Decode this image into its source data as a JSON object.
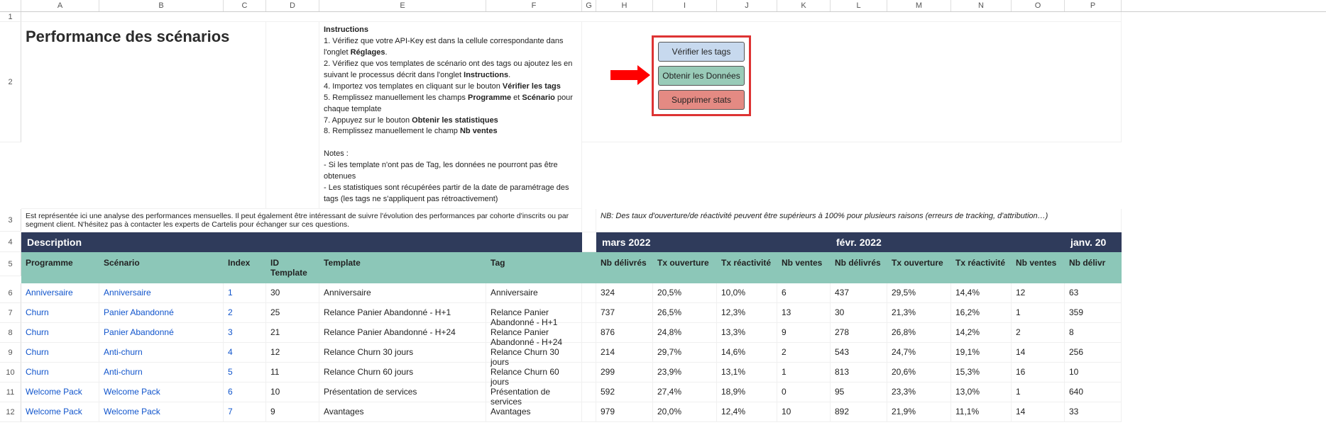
{
  "columns": [
    "",
    "A",
    "B",
    "C",
    "D",
    "E",
    "F",
    "G",
    "H",
    "I",
    "J",
    "K",
    "L",
    "M",
    "N",
    "O",
    "P"
  ],
  "title": "Performance des scénarios",
  "instructions": {
    "heading": "Instructions",
    "lines": [
      "1. Vérifiez que votre API-Key est dans la cellule correspondante dans l'onglet Réglages.",
      "2. Vérifiez que vos templates de scénario ont des tags ou ajoutez les en suivant le processus décrit dans l'onglet Instructions.",
      "4. Importez vos templates en cliquant sur le bouton Vérifier les tags",
      "5. Remplissez manuellement les champs Programme et Scénario pour chaque template",
      "7. Appuyez sur le bouton Obtenir les statistiques",
      "8. Remplissez manuellement le champ Nb ventes"
    ],
    "notes_heading": "Notes :",
    "notes": [
      "- Si les template n'ont pas de Tag, les données ne pourront pas être obtenues",
      "- Les statistiques sont récupérées partir de la date de paramétrage des tags (les tags ne s'appliquent pas rétroactivement)"
    ]
  },
  "nb_note": "NB: Des taux d'ouverture/de réactivité peuvent être supérieurs à 100% pour plusieurs raisons (erreurs de tracking, d'attribution…)",
  "sub_description": "Est représentée ici une analyse des performances mensuelles. Il peut également être intéressant de suivre l'évolution des performances par cohorte d'inscrits ou par segment client. N'hésitez pas à contacter les experts de Cartelis pour échanger sur ces questions.",
  "buttons": {
    "verify": "Vérifier les tags",
    "get": "Obtenir les Données",
    "delete": "Supprimer stats"
  },
  "sections": {
    "description": "Description",
    "mars": "mars 2022",
    "fevr": "févr. 2022",
    "janv": "janv. 20"
  },
  "headers": {
    "programme": "Programme",
    "scenario": "Scénario",
    "index": "Index",
    "id_template": "ID Template",
    "template": "Template",
    "tag": "Tag",
    "nb_delivres": "Nb délivrés",
    "tx_ouv": "Tx ouverture",
    "tx_react": "Tx réactivité",
    "nb_ventes": "Nb ventes",
    "nb_delivr": "Nb délivr"
  },
  "rows": [
    {
      "n": 6,
      "programme": "Anniversaire",
      "scenario": "Anniversaire",
      "index": "1",
      "id_template": "30",
      "template": "Anniversaire",
      "tag": "Anniversaire",
      "m": {
        "d": "324",
        "o": "20,5%",
        "r": "10,0%",
        "v": "6"
      },
      "f": {
        "d": "437",
        "o": "29,5%",
        "r": "14,4%",
        "v": "12"
      },
      "j": {
        "d": "63"
      }
    },
    {
      "n": 7,
      "programme": "Churn",
      "scenario": "Panier Abandonné",
      "index": "2",
      "id_template": "25",
      "template": "Relance Panier Abandonné - H+1",
      "tag": "Relance Panier Abandonné - H+1",
      "m": {
        "d": "737",
        "o": "26,5%",
        "r": "12,3%",
        "v": "13"
      },
      "f": {
        "d": "30",
        "o": "21,3%",
        "r": "16,2%",
        "v": "1"
      },
      "j": {
        "d": "359"
      }
    },
    {
      "n": 8,
      "programme": "Churn",
      "scenario": "Panier Abandonné",
      "index": "3",
      "id_template": "21",
      "template": "Relance Panier Abandonné - H+24",
      "tag": "Relance Panier Abandonné - H+24",
      "m": {
        "d": "876",
        "o": "24,8%",
        "r": "13,3%",
        "v": "9"
      },
      "f": {
        "d": "278",
        "o": "26,8%",
        "r": "14,2%",
        "v": "2"
      },
      "j": {
        "d": "8"
      }
    },
    {
      "n": 9,
      "programme": "Churn",
      "scenario": "Anti-churn",
      "index": "4",
      "id_template": "12",
      "template": "Relance Churn 30 jours",
      "tag": "Relance Churn 30 jours",
      "m": {
        "d": "214",
        "o": "29,7%",
        "r": "14,6%",
        "v": "2"
      },
      "f": {
        "d": "543",
        "o": "24,7%",
        "r": "19,1%",
        "v": "14"
      },
      "j": {
        "d": "256"
      }
    },
    {
      "n": 10,
      "programme": "Churn",
      "scenario": "Anti-churn",
      "index": "5",
      "id_template": "11",
      "template": "Relance Churn 60 jours",
      "tag": "Relance Churn 60 jours",
      "m": {
        "d": "299",
        "o": "23,9%",
        "r": "13,1%",
        "v": "1"
      },
      "f": {
        "d": "813",
        "o": "20,6%",
        "r": "15,3%",
        "v": "16"
      },
      "j": {
        "d": "10"
      }
    },
    {
      "n": 11,
      "programme": "Welcome Pack",
      "scenario": "Welcome Pack",
      "index": "6",
      "id_template": "10",
      "template": "Présentation de services",
      "tag": "Présentation de services",
      "m": {
        "d": "592",
        "o": "27,4%",
        "r": "18,9%",
        "v": "0"
      },
      "f": {
        "d": "95",
        "o": "23,3%",
        "r": "13,0%",
        "v": "1"
      },
      "j": {
        "d": "640"
      }
    },
    {
      "n": 12,
      "programme": "Welcome Pack",
      "scenario": "Welcome Pack",
      "index": "7",
      "id_template": "9",
      "template": "Avantages",
      "tag": "Avantages",
      "m": {
        "d": "979",
        "o": "20,0%",
        "r": "12,4%",
        "v": "10"
      },
      "f": {
        "d": "892",
        "o": "21,9%",
        "r": "11,1%",
        "v": "14"
      },
      "j": {
        "d": "33"
      }
    }
  ]
}
